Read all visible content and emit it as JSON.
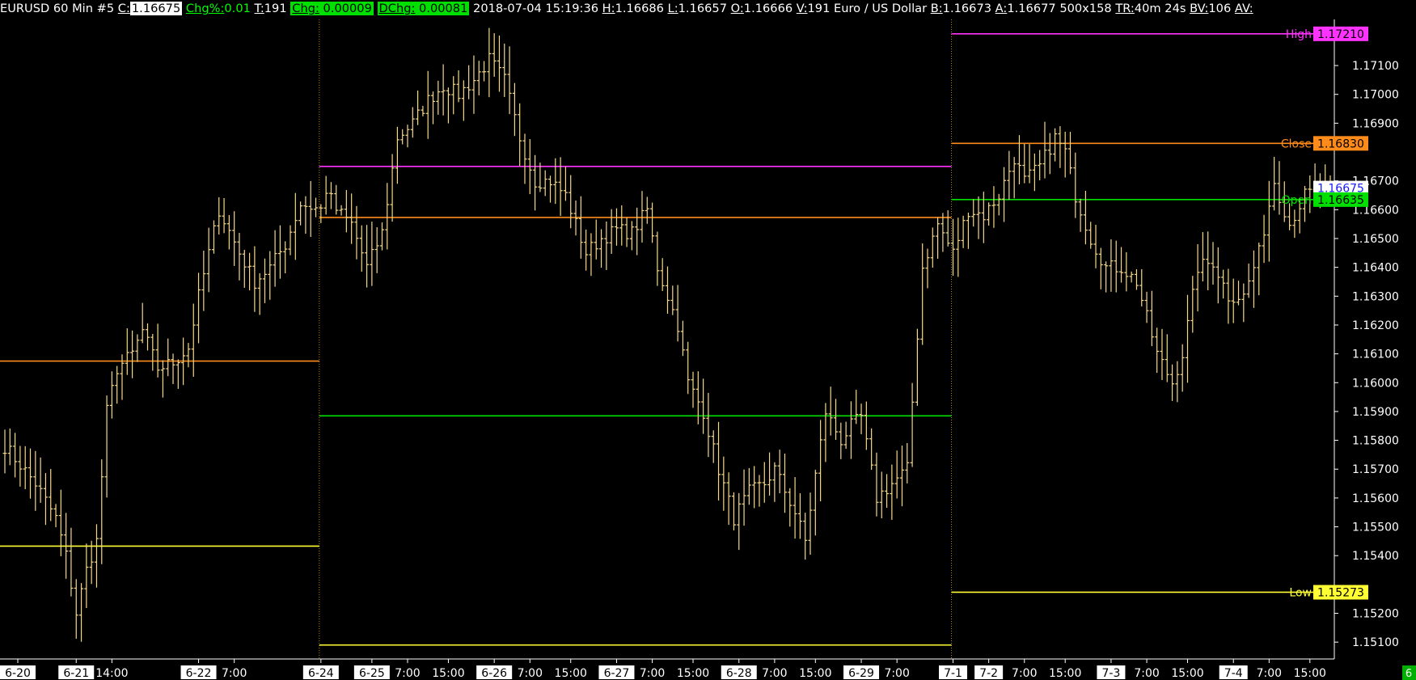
{
  "header": {
    "symbol": "EURUSD",
    "interval": "60 Min",
    "study": "#5",
    "close_label": "C:",
    "close_value": "1.16675",
    "chgpct_label": "Chg%:",
    "chgpct_value": "0.01",
    "ticks_label": "T:",
    "ticks_value": "191",
    "chg_label": "Chg:",
    "chg_value": "0.00009",
    "dchg_label": "DChg:",
    "dchg_value": "0.00081",
    "datetime": "2018-07-04 15:19:36",
    "high_label": "H:",
    "high_value": "1.16686",
    "low_label": "L:",
    "low_value": "1.16657",
    "open_label": "O:",
    "open_value": "1.16666",
    "volume_label": "V:",
    "volume_value": "191",
    "name": "Euro / US Dollar",
    "bid_label": "B:",
    "bid_value": "1.16673",
    "ask_label": "A:",
    "ask_value": "1.16677",
    "size": "500x158",
    "tr_label": "TR:",
    "tr_value": "40m 24s",
    "bv_label": "BV:",
    "bv_value": "106",
    "av_label": "AV:"
  },
  "corner_badge": "6",
  "colors": {
    "background": "#000000",
    "bars": "#f5d98b",
    "high": "#ff33ff",
    "close": "#ff8c1a",
    "open": "#00e000",
    "low": "#ffff33",
    "last_price_box": "#1a1aff",
    "divider": "#b8860b",
    "axis_text": "#ffffff"
  },
  "chart_data": {
    "type": "ohlc",
    "ylim": [
      1.1505,
      1.1726
    ],
    "yticks": [
      "1.17100",
      "1.17000",
      "1.16900",
      "1.16700",
      "1.16600",
      "1.16500",
      "1.16400",
      "1.16300",
      "1.16200",
      "1.16100",
      "1.16000",
      "1.15900",
      "1.15800",
      "1.15700",
      "1.15600",
      "1.15500",
      "1.15400",
      "1.15200",
      "1.15100"
    ],
    "xticks": [
      {
        "label": "6-20",
        "hl": true,
        "i": 0
      },
      {
        "label": "6-21",
        "hl": true,
        "i": 14
      },
      {
        "label": "14:00",
        "hl": false,
        "i": 21
      },
      {
        "label": "6-22",
        "hl": true,
        "i": 38
      },
      {
        "label": "7:00",
        "hl": false,
        "i": 45
      },
      {
        "label": "6-24",
        "hl": true,
        "i": 62
      },
      {
        "label": "6-25",
        "hl": true,
        "i": 72
      },
      {
        "label": "7:00",
        "hl": false,
        "i": 79
      },
      {
        "label": "15:00",
        "hl": false,
        "i": 87
      },
      {
        "label": "6-26",
        "hl": true,
        "i": 96
      },
      {
        "label": "7:00",
        "hl": false,
        "i": 103
      },
      {
        "label": "15:00",
        "hl": false,
        "i": 111
      },
      {
        "label": "6-27",
        "hl": true,
        "i": 120
      },
      {
        "label": "7:00",
        "hl": false,
        "i": 127
      },
      {
        "label": "15:00",
        "hl": false,
        "i": 135
      },
      {
        "label": "6-28",
        "hl": true,
        "i": 144
      },
      {
        "label": "7:00",
        "hl": false,
        "i": 151
      },
      {
        "label": "15:00",
        "hl": false,
        "i": 159
      },
      {
        "label": "6-29",
        "hl": true,
        "i": 168
      },
      {
        "label": "7:00",
        "hl": false,
        "i": 175
      },
      {
        "label": "7-1",
        "hl": true,
        "i": 186
      },
      {
        "label": "7-2",
        "hl": true,
        "i": 193
      },
      {
        "label": "7:00",
        "hl": false,
        "i": 200
      },
      {
        "label": "15:00",
        "hl": false,
        "i": 208
      },
      {
        "label": "7-3",
        "hl": true,
        "i": 217
      },
      {
        "label": "7:00",
        "hl": false,
        "i": 224
      },
      {
        "label": "15:00",
        "hl": false,
        "i": 232
      },
      {
        "label": "7-4",
        "hl": true,
        "i": 241
      },
      {
        "label": "7:00",
        "hl": false,
        "i": 248
      },
      {
        "label": "15:00",
        "hl": false,
        "i": 256
      }
    ],
    "week_dividers_i": [
      62,
      186
    ],
    "bar_count": 261,
    "anchors": [
      [
        0,
        1.1578
      ],
      [
        6,
        1.1565
      ],
      [
        10,
        1.1553
      ],
      [
        12,
        1.154
      ],
      [
        14,
        1.152
      ],
      [
        16,
        1.1535
      ],
      [
        18,
        1.1545
      ],
      [
        20,
        1.159
      ],
      [
        22,
        1.1605
      ],
      [
        25,
        1.161
      ],
      [
        27,
        1.1618
      ],
      [
        30,
        1.1605
      ],
      [
        33,
        1.1607
      ],
      [
        36,
        1.1612
      ],
      [
        38,
        1.163
      ],
      [
        42,
        1.166
      ],
      [
        46,
        1.1645
      ],
      [
        49,
        1.1635
      ],
      [
        52,
        1.164
      ],
      [
        55,
        1.1648
      ],
      [
        58,
        1.1662
      ],
      [
        62,
        1.166
      ],
      [
        63,
        1.1667
      ],
      [
        65,
        1.166
      ],
      [
        68,
        1.1655
      ],
      [
        71,
        1.164
      ],
      [
        74,
        1.1652
      ],
      [
        77,
        1.1685
      ],
      [
        80,
        1.169
      ],
      [
        83,
        1.1698
      ],
      [
        86,
        1.1703
      ],
      [
        89,
        1.17
      ],
      [
        92,
        1.1705
      ],
      [
        95,
        1.1712
      ],
      [
        98,
        1.1705
      ],
      [
        101,
        1.1685
      ],
      [
        104,
        1.167
      ],
      [
        107,
        1.167
      ],
      [
        110,
        1.1665
      ],
      [
        114,
        1.1645
      ],
      [
        117,
        1.165
      ],
      [
        120,
        1.1653
      ],
      [
        123,
        1.1652
      ],
      [
        126,
        1.166
      ],
      [
        128,
        1.164
      ],
      [
        132,
        1.162
      ],
      [
        134,
        1.16
      ],
      [
        137,
        1.159
      ],
      [
        140,
        1.157
      ],
      [
        143,
        1.1553
      ],
      [
        146,
        1.1562
      ],
      [
        149,
        1.1565
      ],
      [
        151,
        1.157
      ],
      [
        155,
        1.1555
      ],
      [
        157,
        1.1545
      ],
      [
        159,
        1.1568
      ],
      [
        161,
        1.159
      ],
      [
        164,
        1.158
      ],
      [
        166,
        1.1585
      ],
      [
        168,
        1.1588
      ],
      [
        171,
        1.156
      ],
      [
        174,
        1.1565
      ],
      [
        177,
        1.157
      ],
      [
        180,
        1.164
      ],
      [
        183,
        1.1655
      ],
      [
        186,
        1.1645
      ],
      [
        189,
        1.166
      ],
      [
        192,
        1.1658
      ],
      [
        195,
        1.1665
      ],
      [
        198,
        1.1678
      ],
      [
        200,
        1.167
      ],
      [
        203,
        1.1675
      ],
      [
        206,
        1.1685
      ],
      [
        208,
        1.168
      ],
      [
        210,
        1.1665
      ],
      [
        213,
        1.165
      ],
      [
        216,
        1.164
      ],
      [
        219,
        1.164
      ],
      [
        222,
        1.1635
      ],
      [
        226,
        1.161
      ],
      [
        229,
        1.16
      ],
      [
        231,
        1.161
      ],
      [
        234,
        1.164
      ],
      [
        237,
        1.1642
      ],
      [
        240,
        1.163
      ],
      [
        243,
        1.163
      ],
      [
        246,
        1.1645
      ],
      [
        249,
        1.167
      ],
      [
        252,
        1.1655
      ],
      [
        255,
        1.1665
      ],
      [
        258,
        1.1667
      ],
      [
        260,
        1.16675
      ]
    ],
    "reference_lines": [
      {
        "from_i": 0,
        "to_i": 62,
        "value": 1.16075,
        "color": "#ff8c1a"
      },
      {
        "from_i": 0,
        "to_i": 62,
        "value": 1.15433,
        "color": "#ffff33"
      },
      {
        "from_i": 62,
        "to_i": 186,
        "value": 1.1675,
        "color": "#ff33ff"
      },
      {
        "from_i": 62,
        "to_i": 186,
        "value": 1.16573,
        "color": "#ff8c1a"
      },
      {
        "from_i": 62,
        "to_i": 186,
        "value": 1.15885,
        "color": "#00e000"
      },
      {
        "from_i": 62,
        "to_i": 186,
        "value": 1.1509,
        "color": "#ffff33"
      },
      {
        "from_i": 186,
        "to_i": 261,
        "value": 1.1721,
        "color": "#ff33ff"
      },
      {
        "from_i": 186,
        "to_i": 261,
        "value": 1.1683,
        "color": "#ff8c1a"
      },
      {
        "from_i": 186,
        "to_i": 261,
        "value": 1.16635,
        "color": "#00e000"
      },
      {
        "from_i": 186,
        "to_i": 261,
        "value": 1.15273,
        "color": "#ffff33"
      }
    ],
    "right_labels": [
      {
        "text": "High",
        "value_text": "1.17210",
        "value": 1.1721,
        "color": "#ff33ff"
      },
      {
        "text": "Close",
        "value_text": "1.16830",
        "value": 1.1683,
        "color": "#ff8c1a"
      },
      {
        "text": "",
        "value_text": "1.16675",
        "value": 1.16675,
        "color": "#1a1aff",
        "box_bg": "#ffffff"
      },
      {
        "text": "Open",
        "value_text": "1.16635",
        "value": 1.16635,
        "color": "#00e000"
      },
      {
        "text": "Low",
        "value_text": "1.15273",
        "value": 1.15273,
        "color": "#ffff33"
      }
    ]
  }
}
